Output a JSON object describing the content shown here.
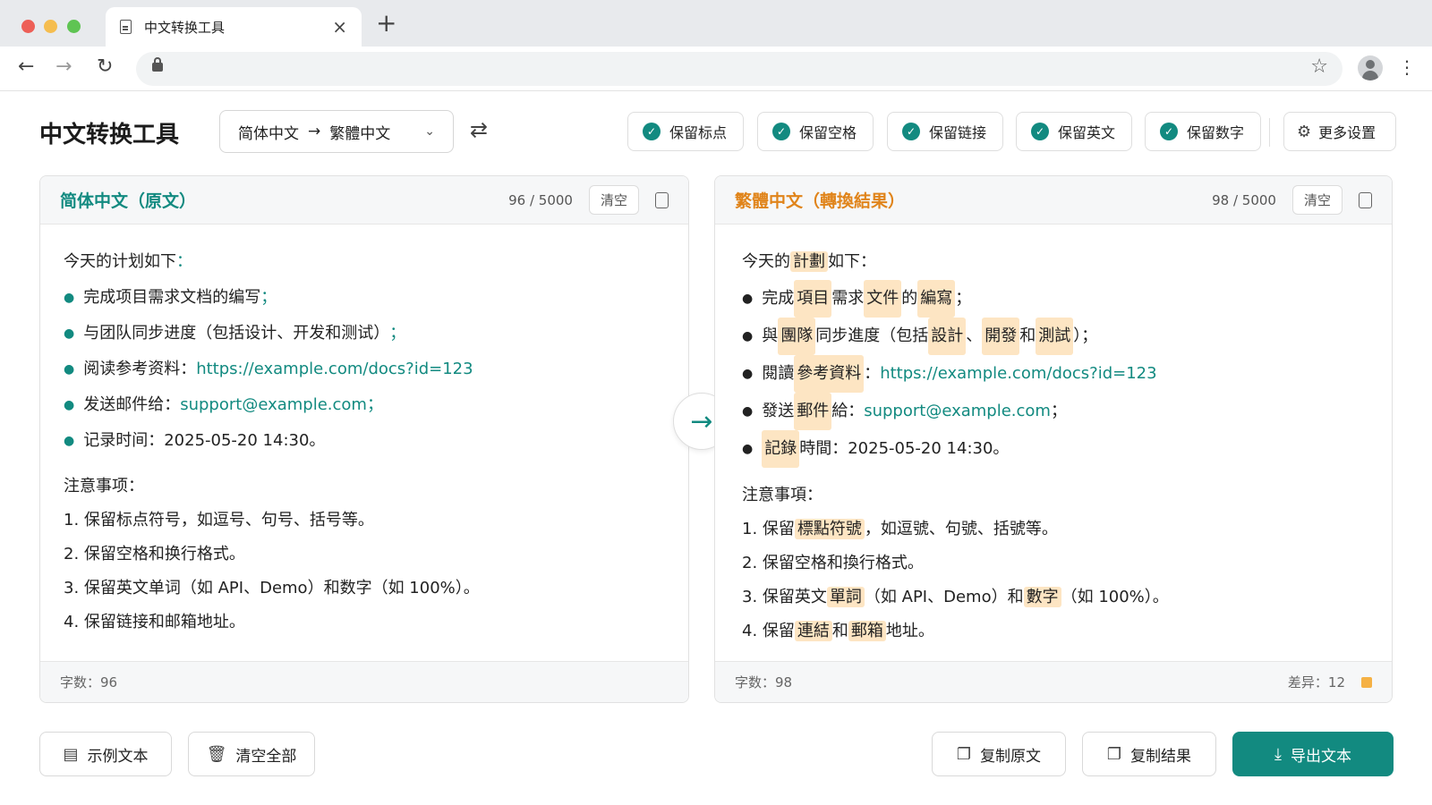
{
  "browser": {
    "tab_title": "中文转换工具",
    "tab_close": "×",
    "new_tab": "+",
    "back": "←",
    "forward": "→",
    "reload": "↻",
    "star": "☆",
    "menu": "⋮"
  },
  "header": {
    "title": "中文转换工具",
    "source_lang": "简体中文",
    "arrow": "→",
    "target_lang": "繁體中文",
    "chevron": "⌄",
    "swap": "⇄"
  },
  "options": [
    {
      "label": "保留标点",
      "checked": true
    },
    {
      "label": "保留空格",
      "checked": true
    },
    {
      "label": "保留链接",
      "checked": true
    },
    {
      "label": "保留英文",
      "checked": true
    },
    {
      "label": "保留数字",
      "checked": true
    }
  ],
  "more_settings": "更多设置",
  "left": {
    "title": "简体中文（原文）",
    "count": "96 / 5000",
    "clear": "清空",
    "intro": "今天的计划如下",
    "colon": "：",
    "items": [
      {
        "text": "完成项目需求文档的编写",
        "end": "；"
      },
      {
        "text": "与团队同步进度（包括设计、开发和测试）",
        "end": "；"
      },
      {
        "text": "阅读参考资料：",
        "link": "https://example.com/docs?id=123"
      },
      {
        "text": "发送邮件给：",
        "link": "support@example.com",
        "end": "；"
      },
      {
        "text": "记录时间：2025-05-20 14:30。"
      }
    ],
    "notes_title": "注意事项：",
    "notes": [
      "1. 保留标点符号，如逗号、句号、括号等。",
      "2. 保留空格和换行格式。",
      "3. 保留英文单词（如 API、Demo）和数字（如 100%）。",
      "4. 保留链接和邮箱地址。"
    ],
    "footer": "字数：96"
  },
  "right": {
    "title": "繁體中文（轉換結果）",
    "count": "98 / 5000",
    "clear": "清空",
    "footer": "字数：98",
    "diff": "差异：12",
    "lines": {
      "l1a": "今天的",
      "l1b": "計劃",
      "l1c": "如下：",
      "l2a": "完成",
      "l2b": "項目",
      "l2c": "需求",
      "l2d": "文件",
      "l2e": "的",
      "l2f": "編寫",
      "l2g": "；",
      "l3a": "與",
      "l3b": "團隊",
      "l3c": "同步進度（包括",
      "l3d": "設計",
      "l3e": "、",
      "l3f": "開發",
      "l3g": "和",
      "l3h": "測試",
      "l3i": "）；",
      "l4a": "閱讀",
      "l4b": "參考資料",
      "l4c": "：",
      "l4d": "https://example.com/docs?id=123",
      "l5a": "發送",
      "l5b": "郵件",
      "l5c": "給：",
      "l5d": "support@example.com",
      "l5e": "；",
      "l6a": "記錄",
      "l6b": "時間：2025-05-20 14:30。",
      "notes_title": "注意事項：",
      "n1a": "1. 保留",
      "n1b": "標點符號",
      "n1c": "，如逗號、句號、括號等。",
      "n2": "2. 保留空格和換行格式。",
      "n3a": "3. 保留英文",
      "n3b": "單詞",
      "n3c": "（如 API、Demo）和",
      "n3d": "數字",
      "n3e": "（如 100%）。",
      "n4a": "4. 保留",
      "n4b": "連結",
      "n4c": "和",
      "n4d": "郵箱",
      "n4e": "地址。"
    }
  },
  "convert_arrow": "→",
  "bottom": {
    "sample": "示例文本",
    "clear_all": "清空全部",
    "copy_source": "复制原文",
    "copy_result": "复制结果",
    "export": "导出文本"
  },
  "colors": {
    "accent": "#128a80",
    "result_title": "#e0841a",
    "highlight": "#fde5c3"
  }
}
